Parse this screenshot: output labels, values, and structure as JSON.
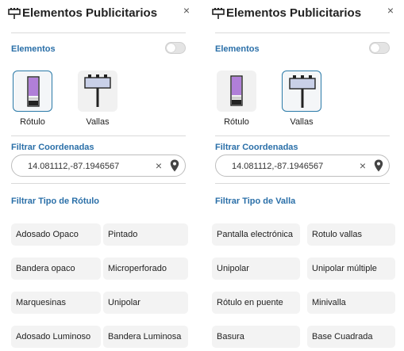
{
  "left_panel": {
    "title": "Elementos Publicitarios",
    "close_glyph": "×",
    "elements_label": "Elementos",
    "toggle_on": false,
    "types": [
      {
        "label": "Rótulo",
        "icon": "rotulo-icon",
        "selected": true
      },
      {
        "label": "Vallas",
        "icon": "valla-icon",
        "selected": false
      }
    ],
    "coords_label": "Filtrar Coordenadas",
    "coords_value": "14.081112,-87.1946567",
    "clear_glyph": "×",
    "filter_label": "Filtrar Tipo de Rótulo",
    "options": [
      "Adosado Opaco",
      "Pintado",
      "Bandera opaco",
      "Microperforado",
      "Marquesinas",
      "Unipolar",
      "Adosado Luminoso",
      "Bandera Luminosa"
    ]
  },
  "right_panel": {
    "title": "Elementos Publicitarios",
    "close_glyph": "×",
    "elements_label": "Elementos",
    "toggle_on": false,
    "types": [
      {
        "label": "Rótulo",
        "icon": "rotulo-icon",
        "selected": false
      },
      {
        "label": "Vallas",
        "icon": "valla-icon",
        "selected": true
      }
    ],
    "coords_label": "Filtrar Coordenadas",
    "coords_value": "14.081112,-87.1946567",
    "clear_glyph": "×",
    "filter_label": "Filtrar Tipo de Valla",
    "options": [
      "Pantalla electrónica",
      "Rotulo vallas",
      "Unipolar",
      "Unipolar múltiple",
      "Rótulo en puente",
      "Minivalla",
      "Basura",
      "Base Cuadrada"
    ]
  },
  "colors": {
    "accent": "#2a6fa8",
    "selected_border": "#2b7aa8",
    "sign_purple": "#b07fd8",
    "chip_bg": "#f3f3f3"
  }
}
